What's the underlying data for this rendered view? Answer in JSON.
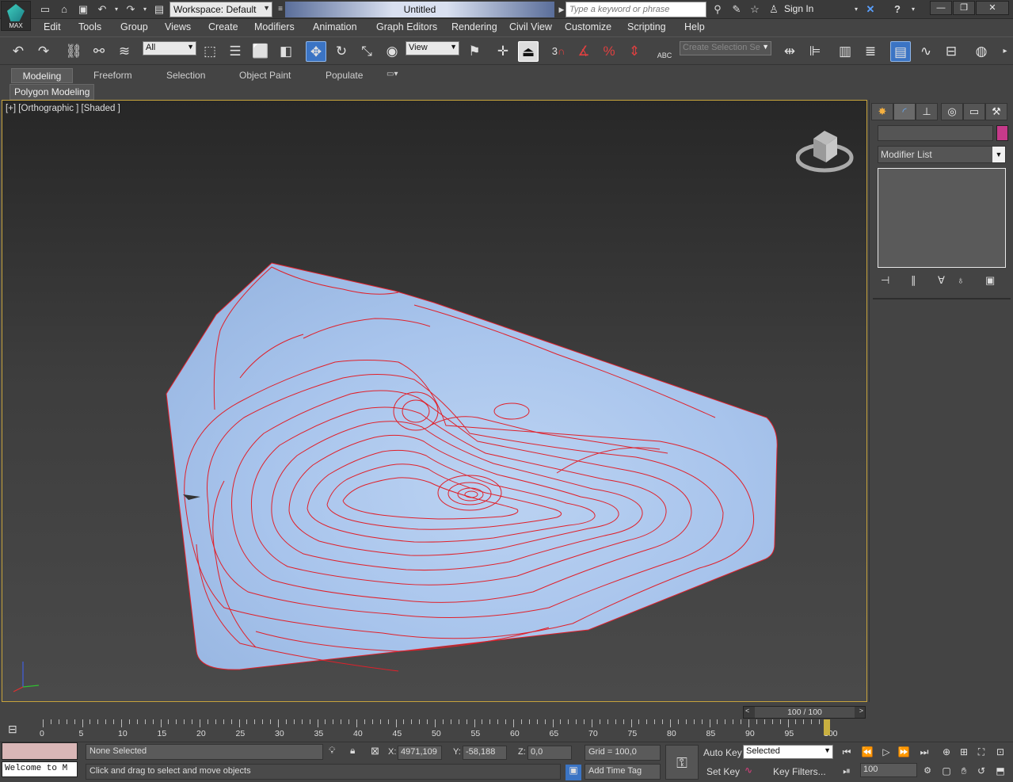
{
  "app": {
    "title": "Untitled",
    "logo_text": "MAX",
    "workspace": "Workspace: Default",
    "search_placeholder": "Type a keyword or phrase",
    "sign_in": "Sign In"
  },
  "menu": [
    "Edit",
    "Tools",
    "Group",
    "Views",
    "Create",
    "Modifiers",
    "Animation",
    "Graph Editors",
    "Rendering",
    "Civil View",
    "Customize",
    "Scripting",
    "Help"
  ],
  "toolbar": {
    "selection_filter": "All",
    "ref_coord": "View",
    "named_selection": "Create Selection Se",
    "snap_label": "3",
    "abc_label": "ABC"
  },
  "ribbon": {
    "tabs": [
      "Modeling",
      "Freeform",
      "Selection",
      "Object Paint",
      "Populate"
    ],
    "active_tab": "Modeling",
    "panel": "Polygon Modeling"
  },
  "viewport": {
    "label": "[+] [Orthographic ] [Shaded ]",
    "mesh_color": "#a8c4ec",
    "contour_color": "#e0202a"
  },
  "command_panel": {
    "modifier_list": "Modifier List",
    "swatch_color": "#c63a8a"
  },
  "timeline": {
    "slider_text": "100 / 100",
    "tick_labels": [
      "0",
      "5",
      "10",
      "15",
      "20",
      "25",
      "30",
      "35",
      "40",
      "45",
      "50",
      "55",
      "60",
      "65",
      "70",
      "75",
      "80",
      "85",
      "90",
      "95",
      "100"
    ],
    "current_frame": 100
  },
  "status": {
    "selection": "None Selected",
    "prompt": "Click and drag to select and move objects",
    "maxscript": "Welcome to M",
    "x_label": "X:",
    "x_value": "4971,109",
    "y_label": "Y:",
    "y_value": "-58,188",
    "z_label": "Z:",
    "z_value": "0,0",
    "grid": "Grid = 100,0",
    "add_time_tag": "Add Time Tag",
    "auto_key": "Auto Key",
    "set_key": "Set Key",
    "key_mode": "Selected",
    "key_filters": "Key Filters...",
    "frame_value": "100"
  }
}
